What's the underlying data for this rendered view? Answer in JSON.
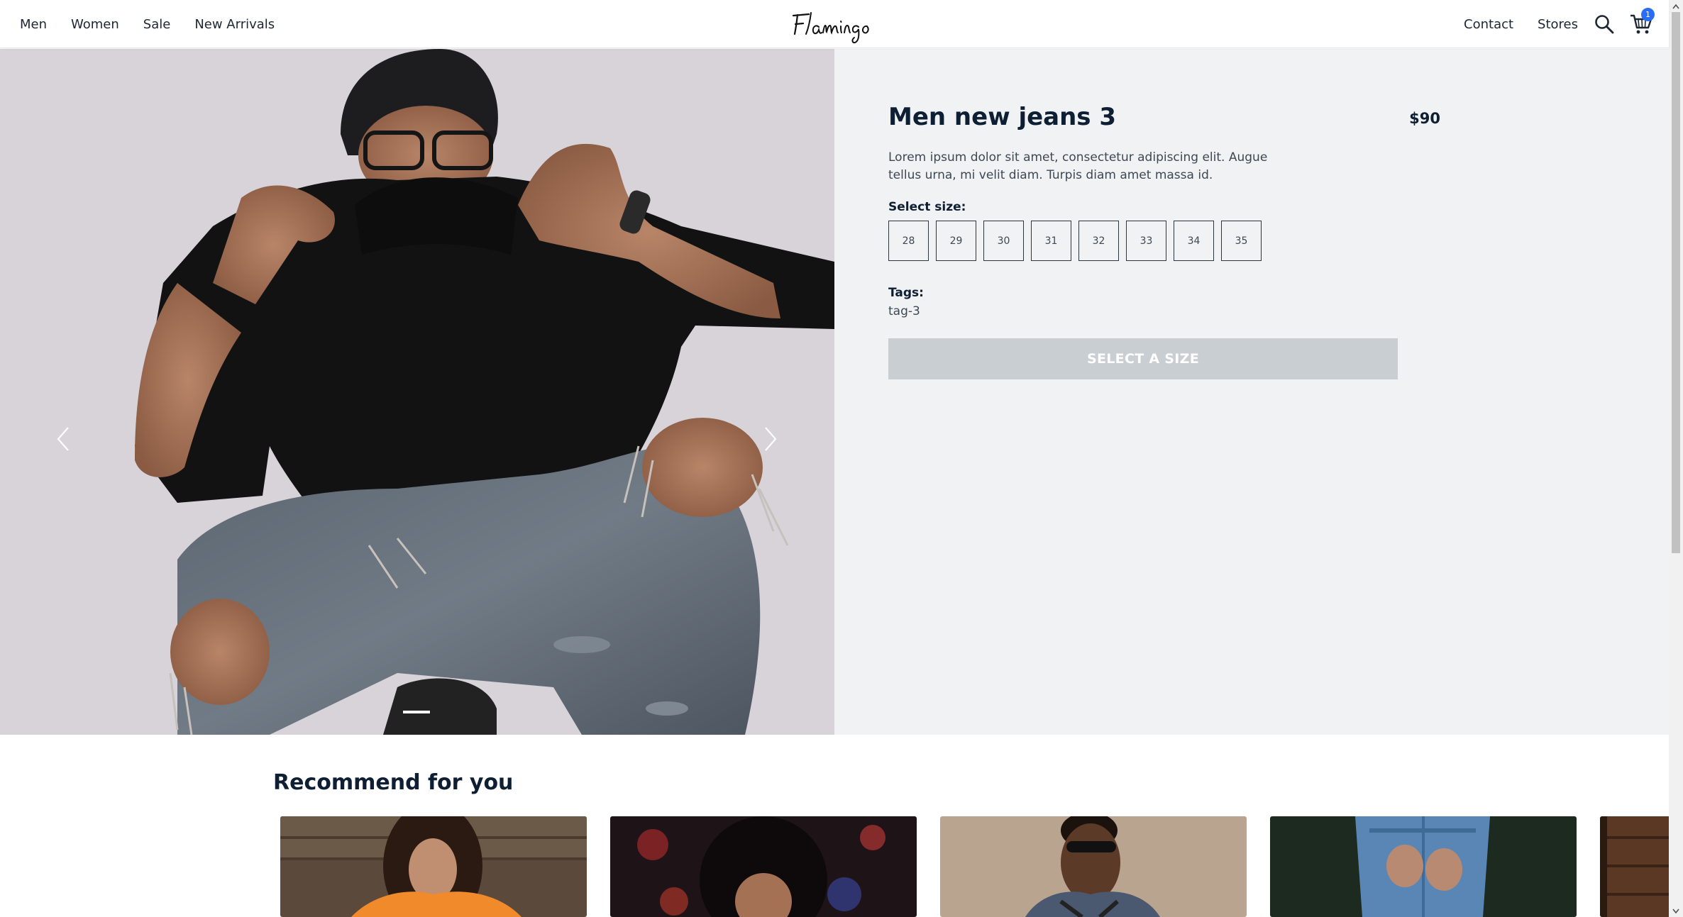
{
  "header": {
    "nav_left": [
      "Men",
      "Women",
      "Sale",
      "New Arrivals"
    ],
    "logo_text": "Flamingo",
    "contact": "Contact",
    "stores": "Stores",
    "cart_count": "1"
  },
  "product": {
    "title": "Men new jeans 3",
    "price": "$90",
    "description": "Lorem ipsum dolor sit amet, consectetur adipiscing elit. Augue tellus urna, mi velit diam. Turpis diam amet massa id.",
    "size_label": "Select size:",
    "sizes": [
      "28",
      "29",
      "30",
      "31",
      "32",
      "33",
      "34",
      "35"
    ],
    "tags_label": "Tags:",
    "tag": "tag-3",
    "cta_label": "SELECT A SIZE"
  },
  "recommend": {
    "title": "Recommend for you"
  },
  "colors": {
    "text_dark": "#0e1f33",
    "panel_bg": "#f0f2f4",
    "cta_disabled": "#c9ced3",
    "badge": "#2a6df5"
  },
  "icons": {
    "search": "search-icon",
    "cart": "cart-icon",
    "prev": "chevron-left-icon",
    "next": "chevron-right-icon"
  }
}
